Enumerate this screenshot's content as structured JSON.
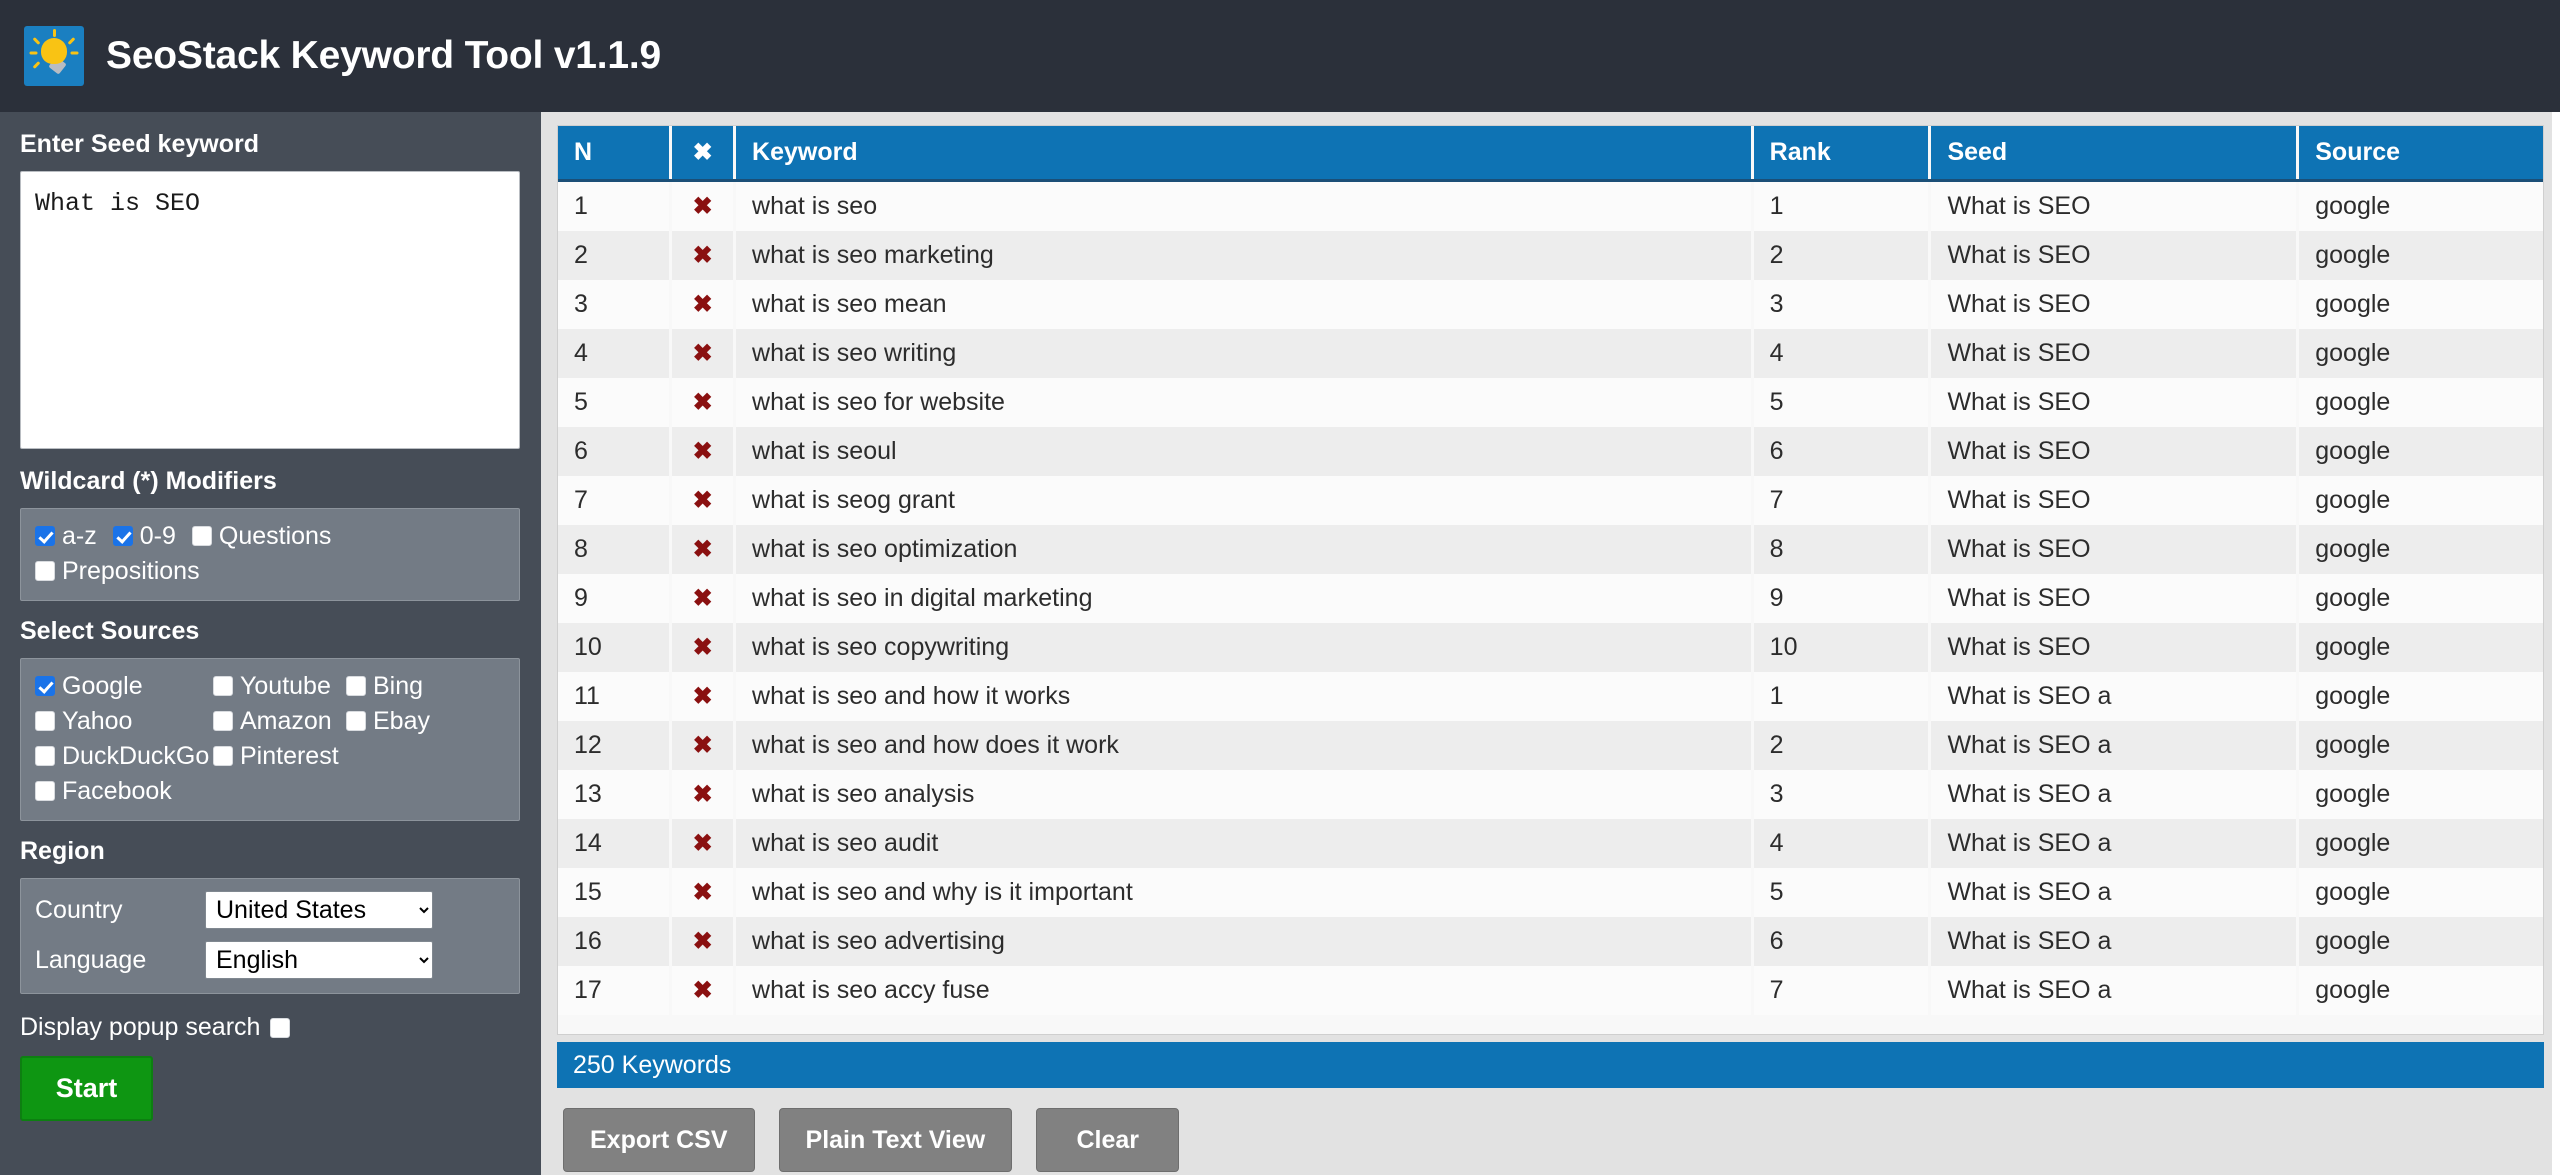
{
  "header": {
    "title": "SeoStack Keyword Tool v1.1.9",
    "logo_icon": "lightbulb-icon"
  },
  "sidebar": {
    "seed": {
      "title": "Enter Seed keyword",
      "value": "What is SEO",
      "placeholder": ""
    },
    "wildcard": {
      "title": "Wildcard (*) Modifiers",
      "options": [
        {
          "label": "a-z",
          "checked": true
        },
        {
          "label": "0-9",
          "checked": true
        },
        {
          "label": "Questions",
          "checked": false
        },
        {
          "label": "Prepositions",
          "checked": false
        }
      ]
    },
    "sources": {
      "title": "Select Sources",
      "options": [
        {
          "label": "Google",
          "checked": true
        },
        {
          "label": "Youtube",
          "checked": false
        },
        {
          "label": "Bing",
          "checked": false
        },
        {
          "label": "Yahoo",
          "checked": false
        },
        {
          "label": "Amazon",
          "checked": false
        },
        {
          "label": "Ebay",
          "checked": false
        },
        {
          "label": "DuckDuckGo",
          "checked": false
        },
        {
          "label": "Pinterest",
          "checked": false
        },
        {
          "label": "",
          "checked": false
        },
        {
          "label": "Facebook",
          "checked": false
        }
      ]
    },
    "region": {
      "title": "Region",
      "country_label": "Country",
      "country_value": "United States",
      "language_label": "Language",
      "language_value": "English"
    },
    "popup": {
      "label": "Display popup search",
      "checked": false
    },
    "start_label": "Start"
  },
  "results": {
    "columns": {
      "n": "N",
      "remove": "✖",
      "keyword": "Keyword",
      "rank": "Rank",
      "seed": "Seed",
      "source": "Source"
    },
    "remove_icon": "✖",
    "rows": [
      {
        "n": "1",
        "keyword": "what is seo",
        "rank": "1",
        "seed": "What is SEO",
        "source": "google"
      },
      {
        "n": "2",
        "keyword": "what is seo marketing",
        "rank": "2",
        "seed": "What is SEO",
        "source": "google"
      },
      {
        "n": "3",
        "keyword": "what is seo mean",
        "rank": "3",
        "seed": "What is SEO",
        "source": "google"
      },
      {
        "n": "4",
        "keyword": "what is seo writing",
        "rank": "4",
        "seed": "What is SEO",
        "source": "google"
      },
      {
        "n": "5",
        "keyword": "what is seo for website",
        "rank": "5",
        "seed": "What is SEO",
        "source": "google"
      },
      {
        "n": "6",
        "keyword": "what is seoul",
        "rank": "6",
        "seed": "What is SEO",
        "source": "google"
      },
      {
        "n": "7",
        "keyword": "what is seog grant",
        "rank": "7",
        "seed": "What is SEO",
        "source": "google"
      },
      {
        "n": "8",
        "keyword": "what is seo optimization",
        "rank": "8",
        "seed": "What is SEO",
        "source": "google"
      },
      {
        "n": "9",
        "keyword": "what is seo in digital marketing",
        "rank": "9",
        "seed": "What is SEO",
        "source": "google"
      },
      {
        "n": "10",
        "keyword": "what is seo copywriting",
        "rank": "10",
        "seed": "What is SEO",
        "source": "google"
      },
      {
        "n": "11",
        "keyword": "what is seo and how it works",
        "rank": "1",
        "seed": "What is SEO a",
        "source": "google"
      },
      {
        "n": "12",
        "keyword": "what is seo and how does it work",
        "rank": "2",
        "seed": "What is SEO a",
        "source": "google"
      },
      {
        "n": "13",
        "keyword": "what is seo analysis",
        "rank": "3",
        "seed": "What is SEO a",
        "source": "google"
      },
      {
        "n": "14",
        "keyword": "what is seo audit",
        "rank": "4",
        "seed": "What is SEO a",
        "source": "google"
      },
      {
        "n": "15",
        "keyword": "what is seo and why is it important",
        "rank": "5",
        "seed": "What is SEO a",
        "source": "google"
      },
      {
        "n": "16",
        "keyword": "what is seo advertising",
        "rank": "6",
        "seed": "What is SEO a",
        "source": "google"
      },
      {
        "n": "17",
        "keyword": "what is seo accy fuse",
        "rank": "7",
        "seed": "What is SEO a",
        "source": "google"
      }
    ],
    "count_label": "250 Keywords",
    "actions": [
      {
        "label": "Export CSV"
      },
      {
        "label": "Plain Text View"
      },
      {
        "label": "Clear"
      }
    ]
  },
  "colors": {
    "accent_blue": "#0e73b4",
    "titlebar": "#2b303a",
    "sidebar": "#464d57",
    "panel": "#737b85",
    "start_green": "#0e9612",
    "remove_red": "#8a1010",
    "checkbox_blue": "#1a73e8"
  }
}
